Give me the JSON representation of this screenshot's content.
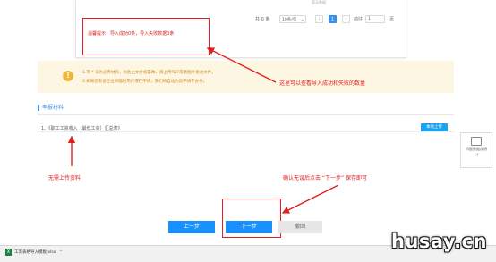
{
  "modal": {
    "empty_text": "暂无数据",
    "import_hint": "温馨提示：导入成功0条，导入失败数据0条"
  },
  "pager": {
    "total": "共 0 条",
    "page_size": "10条/页",
    "prev": "‹",
    "current_page": "1",
    "next": "›",
    "goto_label": "前往",
    "goto_value": "1",
    "goto_unit": "页"
  },
  "notice": {
    "line1": "1.带 * 号为必传材料，为防止文件被篡改，请上传PDF或者图片格式文件。",
    "line2": "2.如果您有该企业的临时用户或在申请，我们将自动为您申请不办件。"
  },
  "annotations": {
    "view_counts": "这里可以查看导入成功和失败的数量",
    "no_upload": "无需上传资料",
    "confirm_next": "确认无误后点击 “下一步” 保存即可"
  },
  "section": {
    "title": "申报材料",
    "item_label": "1、《职工工资收入（最低工资）汇总表》",
    "upload_button": "本地上传"
  },
  "side": {
    "feedback_label": "问题数据反馈"
  },
  "actions": {
    "prev": "上一步",
    "next": "下一步",
    "back": "撤回"
  },
  "download": {
    "file_name": "工资表格导入模板.xlsx"
  },
  "watermark": "husay.cn",
  "colors": {
    "accent": "#1890ff",
    "annotation": "#e02020",
    "notice_bg": "#fdf6e2",
    "notice_text": "#d08a25"
  }
}
